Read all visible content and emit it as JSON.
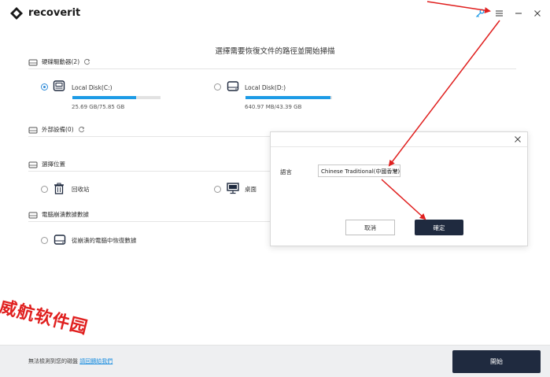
{
  "app": {
    "name": "recoverit"
  },
  "titlebar": {
    "icons": [
      "key-icon",
      "menu-icon",
      "minimize-icon",
      "close-icon"
    ]
  },
  "main": {
    "title": "選擇需要恢復文件的路徑並開始掃描"
  },
  "hard_drives": {
    "label": "硬碟驅動器(2)",
    "drives": [
      {
        "name": "Local Disk(C:)",
        "size": "25.69  GB/75.85  GB",
        "used_fraction": 0.72,
        "selected": true
      },
      {
        "name": "Local Disk(D:)",
        "size": "640.97  MB/43.39  GB",
        "used_fraction": 0.98,
        "selected": false
      }
    ]
  },
  "external": {
    "label": "外部設備(0)"
  },
  "location": {
    "label": "選擇位置",
    "items": [
      {
        "name": "回收站",
        "icon": "trash-icon"
      },
      {
        "name": "桌面",
        "icon": "desktop-icon"
      }
    ]
  },
  "crashed": {
    "label": "電腦崩潰數據數據",
    "items": [
      {
        "name": "從崩潰的電腦中恢復數據",
        "icon": "drive-icon"
      }
    ]
  },
  "dialog": {
    "language_label": "語言",
    "language_value": "Chinese Traditional(中國香港)",
    "cancel": "取消",
    "ok": "確定"
  },
  "footer": {
    "text": "無法檢測到您的磁盤 ",
    "link": "請回饋給我們",
    "start": "開始"
  },
  "watermark": "威航软件园",
  "colors": {
    "accent": "#1d9be6",
    "dark_button": "#1f2a3f",
    "annotation": "#e0201f"
  }
}
